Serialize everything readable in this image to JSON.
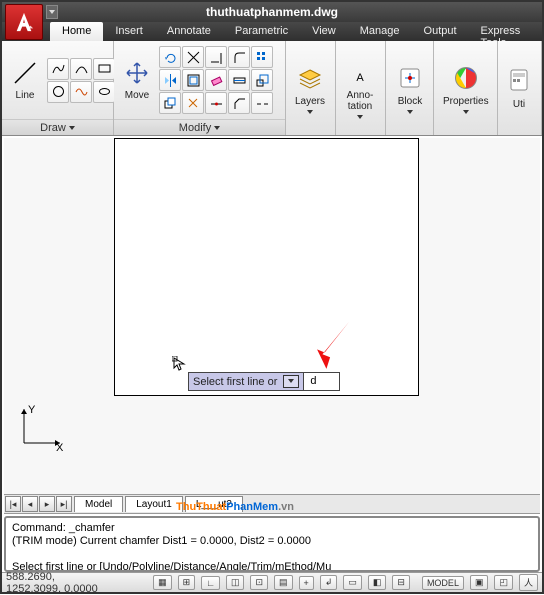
{
  "title": "thuthuatphanmem.dwg",
  "tabs": [
    "Home",
    "Insert",
    "Annotate",
    "Parametric",
    "View",
    "Manage",
    "Output",
    "Express Tools"
  ],
  "activeTab": 0,
  "panels": {
    "draw": {
      "title": "Draw",
      "big": "Line"
    },
    "move": {
      "title": "Modify",
      "big": "Move"
    },
    "layers": "Layers",
    "anno": "Anno-\ntation",
    "block": "Block",
    "props": "Properties",
    "util": "Uti"
  },
  "dyn": {
    "prompt": "Select first line or",
    "value": "d"
  },
  "modelTabs": [
    "Model",
    "Layout1",
    "L___ut2"
  ],
  "cmd": {
    "l1": "Command: _chamfer",
    "l2": "(TRIM mode) Current chamfer Dist1 = 0.0000, Dist2 = 0.0000",
    "l3": "",
    "l4": "Select first line or [Undo/Polyline/Distance/Angle/Trim/mEthod/Mu"
  },
  "status": {
    "coords": "588.2690, 1252.3099, 0.0000",
    "model": "MODEL"
  },
  "wm": {
    "a": "ThuThuat",
    "b": "PhanMem",
    "c": ".vn"
  }
}
